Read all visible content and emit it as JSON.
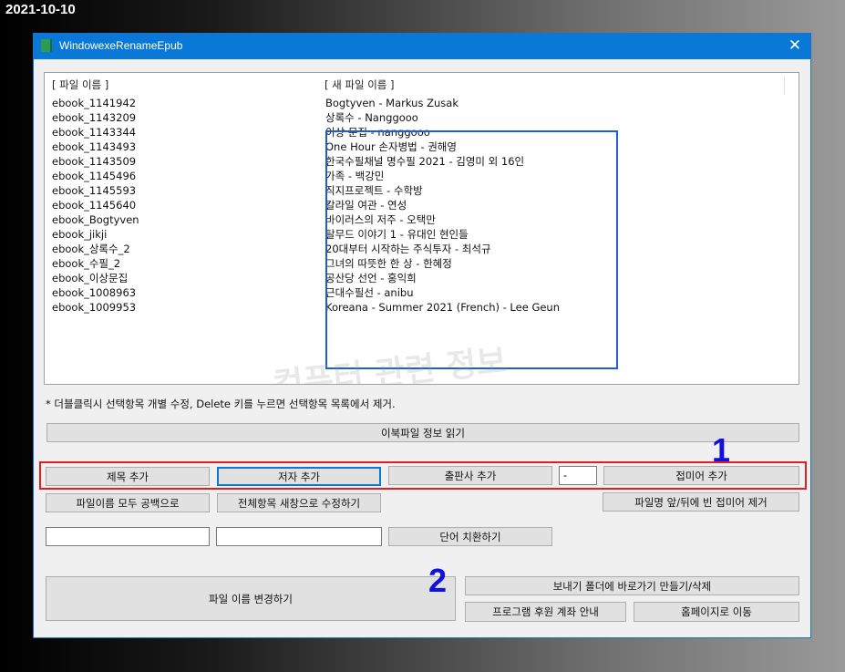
{
  "date_label": "2021-10-10",
  "window": {
    "title": "WindowexeRenameEpub",
    "close_glyph": "✕"
  },
  "columns": {
    "file_name": "[ 파일 이름 ]",
    "new_file_name": "[ 새 파일 이름 ]"
  },
  "rows": [
    {
      "file": "ebook_1141942",
      "new": "Bogtyven - Markus Zusak"
    },
    {
      "file": "ebook_1143209",
      "new": "상록수 - Nanggooo"
    },
    {
      "file": "ebook_1143344",
      "new": "이상 문집 - nanggooo"
    },
    {
      "file": "ebook_1143493",
      "new": "One Hour 손자병법 - 권해영"
    },
    {
      "file": "ebook_1143509",
      "new": "한국수필채널 명수필 2021 - 김영미 외 16인"
    },
    {
      "file": "ebook_1145496",
      "new": "가족 - 백강민"
    },
    {
      "file": "ebook_1145593",
      "new": "직지프로젝트 - 수학방"
    },
    {
      "file": "ebook_1145640",
      "new": "칼라일 여관 - 연성"
    },
    {
      "file": "ebook_Bogtyven",
      "new": "바이러스의 저주 - 오택만"
    },
    {
      "file": "ebook_jikji",
      "new": "탈무드 이야기 1 - 유대인 현인들"
    },
    {
      "file": "ebook_상록수_2",
      "new": "20대부터 시작하는 주식투자  - 최석규"
    },
    {
      "file": "ebook_수필_2",
      "new": "그녀의 따뜻한 한 상 - 한혜정"
    },
    {
      "file": "ebook_이상문집",
      "new": "공산당 선언 - 홍익희"
    },
    {
      "file": "ebook_1008963",
      "new": "근대수필선 - anibu"
    },
    {
      "file": "ebook_1009953",
      "new": "Koreana - Summer 2021 (French) - Lee Geun"
    }
  ],
  "watermark": "컴퓨터 관련 정보",
  "hint": "* 더블클릭시 선택항목 개별 수정, Delete 키를 누르면 선택항목 목록에서 제거.",
  "buttons": {
    "read_ebook_info": "이북파일 정보 읽기",
    "add_title": "제목 추가",
    "add_author": "저자 추가",
    "add_publisher": "출판사 추가",
    "add_affix": "접미어 추가",
    "blank_all": "파일이름 모두 공백으로",
    "edit_all_new_window": "전체항목 새창으로 수정하기",
    "remove_empty_affix": "파일명 앞/뒤에 빈 접미어 제거",
    "replace_word": "단어 치환하기",
    "rename_files": "파일 이름 변경하기",
    "sendto_shortcut": "보내기 폴더에 바로가기 만들기/삭제",
    "donation_info": "프로그램 후원 계좌 안내",
    "go_homepage": "홈페이지로 이동"
  },
  "inputs": {
    "separator_value": "-",
    "replace_from": "",
    "replace_to": ""
  },
  "annotations": {
    "one": "1",
    "two": "2"
  },
  "colors": {
    "accent": "#0a78d7",
    "annotation_red": "#e21f1f",
    "annotation_blue": "#1a5fd6"
  }
}
